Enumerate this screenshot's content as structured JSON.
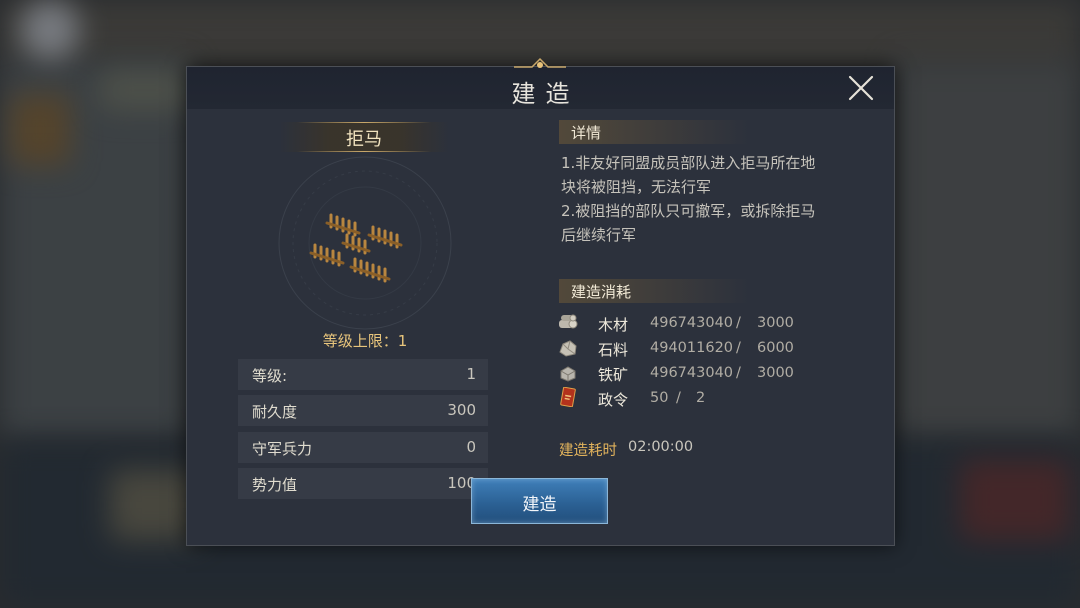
{
  "dialog": {
    "title": "建造",
    "close_icon": "close-icon"
  },
  "structure": {
    "name": "拒马",
    "icon": "barricade-fence-icon",
    "level_cap": "等级上限：1"
  },
  "stats": [
    {
      "label": "等级:",
      "value": "1"
    },
    {
      "label": "耐久度",
      "value": "300"
    },
    {
      "label": "守军兵力",
      "value": "0"
    },
    {
      "label": "势力值",
      "value": "100"
    }
  ],
  "details": {
    "heading": "详情",
    "lines": [
      "1.非友好同盟成员部队进入拒马所在地",
      "块将被阻挡，无法行军",
      "2.被阻挡的部队只可撤军，或拆除拒马",
      "后继续行军"
    ]
  },
  "cost": {
    "heading": "建造消耗",
    "separator": "/",
    "items": [
      {
        "icon": "wood-icon",
        "name": "木材",
        "have": "496743040",
        "need": "3000"
      },
      {
        "icon": "stone-icon",
        "name": "石料",
        "have": "494011620",
        "need": "6000"
      },
      {
        "icon": "iron-ore-icon",
        "name": "铁矿",
        "have": "496743040",
        "need": "3000"
      },
      {
        "icon": "decree-icon",
        "name": "政令",
        "have": "50",
        "need": "2"
      }
    ]
  },
  "build_time": {
    "label": "建造耗时",
    "value": "02:00:00"
  },
  "build_button": {
    "label": "建造"
  },
  "colors": {
    "panel_bg": "#2c313c",
    "gold_text": "#e8c57c",
    "button_blue": "#2a5f92"
  }
}
